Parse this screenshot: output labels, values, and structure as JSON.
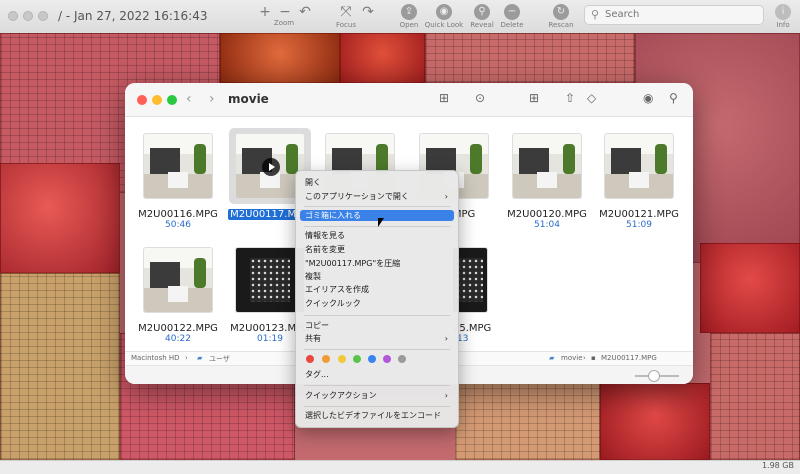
{
  "app": {
    "title": "/ - Jan 27, 2022 16:16:43",
    "toolbar": {
      "plus": "+",
      "minus": "−",
      "zoom_label": "Zoom",
      "focus_label": "Focus",
      "open_label": "Open",
      "quicklook_label": "Quick Look",
      "reveal_label": "Reveal",
      "delete_label": "Delete",
      "rescan_label": "Rescan",
      "info_label": "Info"
    },
    "search": {
      "placeholder": "Search"
    },
    "status": {
      "free_space": "1.98 GB"
    }
  },
  "finder": {
    "title": "movie",
    "files": [
      {
        "name": "M2U00116.MPG",
        "duration": "50:46"
      },
      {
        "name": "M2U00117.MPG",
        "duration": ""
      },
      {
        "name": "",
        "duration": ""
      },
      {
        "name": "19.MPG",
        "duration": "11"
      },
      {
        "name": "M2U00120.MPG",
        "duration": "51:04"
      },
      {
        "name": "M2U00121.MPG",
        "duration": "51:09"
      },
      {
        "name": "M2U00122.MPG",
        "duration": "40:22"
      },
      {
        "name": "M2U00123.MPG",
        "duration": "01:19"
      },
      {
        "name": "",
        "duration": ""
      },
      {
        "name": "25.MPG",
        "duration": "13"
      }
    ],
    "path": {
      "root": "Macintosh HD",
      "users": "ユーザ",
      "folder": "movie",
      "file": "M2U00117.MPG"
    }
  },
  "context_menu": {
    "open": "開く",
    "open_with": "このアプリケーションで開く",
    "move_to_trash": "ゴミ箱に入れる",
    "get_info": "情報を見る",
    "rename": "名前を変更",
    "compress": "\"M2U00117.MPG\"を圧縮",
    "duplicate": "複製",
    "make_alias": "エイリアスを作成",
    "quick_look": "クイックルック",
    "copy": "コピー",
    "share": "共有",
    "tags": "タグ...",
    "quick_actions": "クイックアクション",
    "encode": "選択したビデオファイルをエンコード",
    "tag_colors": [
      "#e8483f",
      "#f29a38",
      "#f1c93a",
      "#5cc34d",
      "#3a84f0",
      "#b157d8",
      "#9a9a9a"
    ]
  }
}
